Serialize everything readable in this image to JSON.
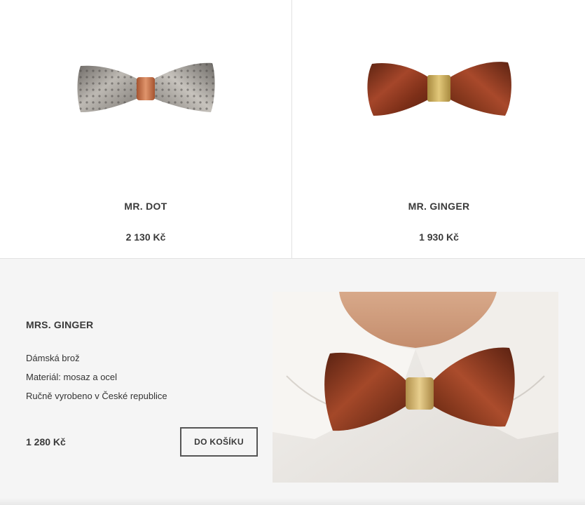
{
  "products": [
    {
      "name": "MR. DOT",
      "price": "2 130 Kč",
      "icon": "silver-dotted-bow-tie"
    },
    {
      "name": "MR. GINGER",
      "price": "1 930 Kč",
      "icon": "wooden-bow-tie"
    }
  ],
  "featured": {
    "name": "MRS. GINGER",
    "description": [
      "Dámská brož",
      "Materiál: mosaz a ocel",
      "Ručně vyrobeno v České republice"
    ],
    "price": "1 280 Kč",
    "button_label": "DO KOŠÍKU",
    "photo": "bow-tie-on-white-collar"
  },
  "colors": {
    "accent_wood": "#8a3a1f",
    "brass": "#c9a652",
    "copper": "#c8734a",
    "steel": "#8f8c88"
  }
}
